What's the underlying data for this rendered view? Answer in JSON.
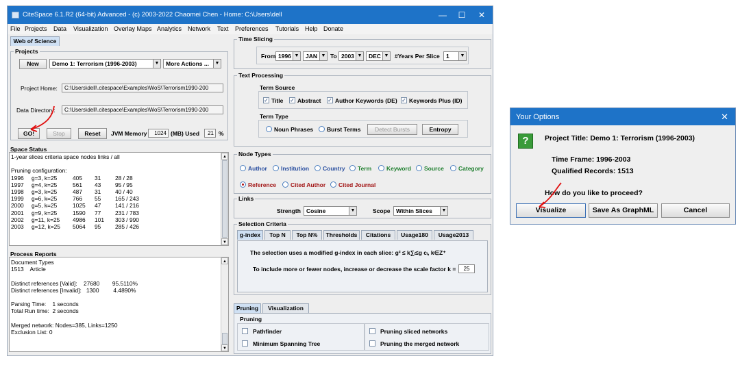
{
  "window": {
    "title": "CiteSpace 6.1.R2 (64-bit) Advanced - (c) 2003-2022 Chaomei Chen - Home: C:\\Users\\dell",
    "controls": {
      "minimize": "—",
      "maximize": "☐",
      "close": "✕"
    }
  },
  "menu": [
    "File",
    "Projects",
    "Data",
    "Visualization",
    "Overlay Maps",
    "Analytics",
    "Network",
    "Text",
    "Preferences",
    "Tutorials",
    "Help",
    "Donate"
  ],
  "left_tab": "Web of Science",
  "projects": {
    "legend": "Projects",
    "new_button": "New",
    "project_select": "Demo 1: Terrorism (1996-2003)",
    "more_actions": "More Actions ...",
    "project_home_label": "Project Home:",
    "project_home_value": "C:\\Users\\dell\\.citespace\\Examples\\WoS\\Terrorism1990-200",
    "data_directory_label": "Data Directory:",
    "data_directory_value": "C:\\Users\\dell\\.citespace\\Examples\\WoS\\Terrorism1990-200"
  },
  "run": {
    "go": "GO!",
    "stop": "Stop",
    "reset": "Reset",
    "jvm_label": "JVM Memory",
    "jvm_value": "1024",
    "used_label": "(MB) Used",
    "used_value": "21",
    "percent": "%"
  },
  "space_status": {
    "legend": "Space Status",
    "header": "1-year slices    criteria  space  nodes  links / all",
    "pruning_label": "Pruning configuration:",
    "rows": [
      [
        "1996",
        "g=3, k=25",
        "405",
        "31",
        "28 / 28"
      ],
      [
        "1997",
        "g=4, k=25",
        "561",
        "43",
        "95 / 95"
      ],
      [
        "1998",
        "g=3, k=25",
        "487",
        "31",
        "40 / 40"
      ],
      [
        "1999",
        "g=6, k=25",
        "766",
        "55",
        "165 / 243"
      ],
      [
        "2000",
        "g=5, k=25",
        "1025",
        "47",
        "141 / 216"
      ],
      [
        "2001",
        "g=9, k=25",
        "1590",
        "77",
        "231 / 783"
      ],
      [
        "2002",
        "g=11, k=25",
        "4986",
        "101",
        "303 / 990"
      ],
      [
        "2003",
        "g=12, k=25",
        "5064",
        "95",
        "285 / 426"
      ]
    ]
  },
  "process_reports": {
    "legend": "Process Reports",
    "lines": [
      "Document Types",
      "1513    Article",
      "",
      "Distinct references [Valid]:    27680        95.5110%",
      "Distinct references [Invalid]:   1300         4.4890%",
      "",
      "Parsing Time:    1 seconds",
      "Total Run time:  2 seconds",
      "",
      "Merged network: Nodes=385, Links=1250",
      "Exclusion List: 0"
    ]
  },
  "time_slicing": {
    "legend": "Time Slicing",
    "from_label": "From",
    "from_year": "1996",
    "from_month": "JAN",
    "to_label": "To",
    "to_year": "2003",
    "to_month": "DEC",
    "years_per_slice_label": "#Years Per Slice",
    "years_per_slice": "1"
  },
  "text_processing": {
    "legend": "Text Processing",
    "term_source_label": "Term Source",
    "term_sources": [
      {
        "label": "Title",
        "checked": true
      },
      {
        "label": "Abstract",
        "checked": true
      },
      {
        "label": "Author Keywords (DE)",
        "checked": true
      },
      {
        "label": "Keywords Plus (ID)",
        "checked": true
      }
    ],
    "term_type_label": "Term Type",
    "noun_phrases": "Noun Phrases",
    "burst_terms": "Burst Terms",
    "detect_bursts": "Detect Bursts",
    "entropy": "Entropy"
  },
  "node_types": {
    "legend": "Node Types",
    "row1": [
      {
        "label": "Author",
        "color": "#2a4fa0"
      },
      {
        "label": "Institution",
        "color": "#2a4fa0"
      },
      {
        "label": "Country",
        "color": "#2a4fa0"
      },
      {
        "label": "Term",
        "color": "#1f7f2f"
      },
      {
        "label": "Keyword",
        "color": "#1f7f2f"
      },
      {
        "label": "Source",
        "color": "#1f7f2f"
      },
      {
        "label": "Category",
        "color": "#1f7f2f"
      }
    ],
    "row2": [
      {
        "label": "Reference",
        "color": "#a21515",
        "selected": true
      },
      {
        "label": "Cited Author",
        "color": "#a21515"
      },
      {
        "label": "Cited Journal",
        "color": "#a21515"
      }
    ]
  },
  "links": {
    "legend": "Links",
    "strength_label": "Strength",
    "strength_value": "Cosine",
    "scope_label": "Scope",
    "scope_value": "Within Slices"
  },
  "selection_criteria": {
    "legend": "Selection Criteria",
    "tabs": [
      "g-index",
      "Top N",
      "Top N%",
      "Thresholds",
      "Citations",
      "Usage180",
      "Usage2013"
    ],
    "active_tab": "g-index",
    "description_text": "The selection uses a modified g-index in each slice:",
    "formula": "g² ≤ k∑ᵢ≤g cᵢ, k∈Z⁺",
    "scale_label": "To include more or fewer nodes, increase or decrease the scale factor k =",
    "k_value": "25"
  },
  "pruning": {
    "tabs": [
      "Pruning",
      "Visualization"
    ],
    "legend": "Pruning",
    "options": [
      "Pathfinder",
      "Pruning sliced networks",
      "Minimum Spanning Tree",
      "Pruning the merged network"
    ]
  },
  "dialog": {
    "title": "Your Options",
    "close": "✕",
    "icon": "question-icon",
    "icon_glyph": "?",
    "project_title": "Project Title: Demo 1: Terrorism (1996-2003)",
    "time_frame": "Time Frame: 1996-2003",
    "qualified_records": "Qualified Records: 1513",
    "question": "How do you like to proceed?",
    "buttons": [
      "Visualize",
      "Save As GraphML",
      "Cancel"
    ]
  },
  "annotation_color": "#e01010"
}
